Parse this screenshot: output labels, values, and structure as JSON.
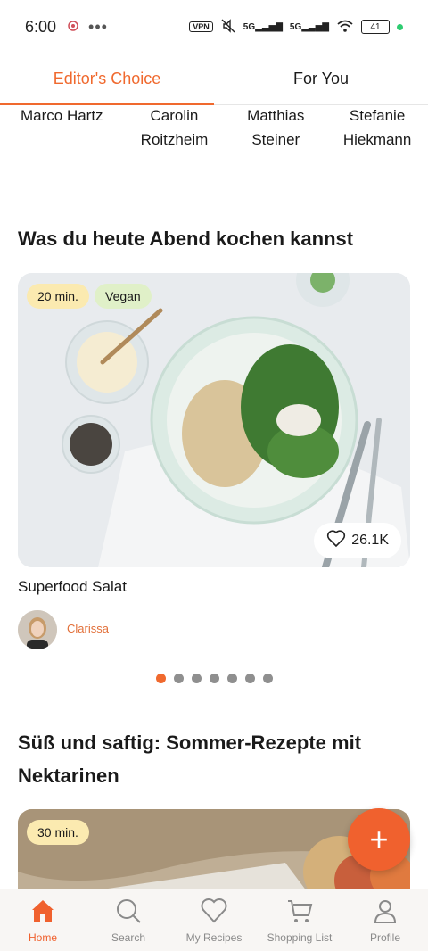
{
  "status_bar": {
    "time": "6:00",
    "vpn": "VPN",
    "signal1": "5G",
    "signal2": "5G",
    "battery": "41"
  },
  "tabs": [
    {
      "label": "Editor's Choice",
      "active": true
    },
    {
      "label": "For You",
      "active": false
    }
  ],
  "authors": [
    {
      "line1": "Marco Hartz",
      "line2": ""
    },
    {
      "line1": "Carolin",
      "line2": "Roitzheim"
    },
    {
      "line1": "Matthias",
      "line2": "Steiner"
    },
    {
      "line1": "Stefanie",
      "line2": "Hiekmann"
    }
  ],
  "section1": {
    "title": "Was du heute Abend kochen kannst",
    "recipe": {
      "time": "20 min.",
      "tag": "Vegan",
      "likes": "26.1K",
      "name": "Superfood Salat",
      "author": "Clarissa"
    },
    "carousel_dots": 7,
    "active_dot": 0
  },
  "section2": {
    "title": "Süß und saftig: Sommer-Rezepte mit Nektarinen",
    "recipe": {
      "time": "30 min."
    }
  },
  "fab": {
    "icon": "plus-icon",
    "label": "+"
  },
  "bottom_nav": [
    {
      "label": "Home",
      "icon": "home-icon",
      "active": true
    },
    {
      "label": "Search",
      "icon": "search-icon",
      "active": false
    },
    {
      "label": "My Recipes",
      "icon": "heart-icon",
      "active": false
    },
    {
      "label": "Shopping List",
      "icon": "cart-icon",
      "active": false
    },
    {
      "label": "Profile",
      "icon": "profile-icon",
      "active": false
    }
  ],
  "colors": {
    "accent": "#f0692e",
    "time_pill": "#fbeab0",
    "vegan_pill": "#e0f0c8"
  }
}
